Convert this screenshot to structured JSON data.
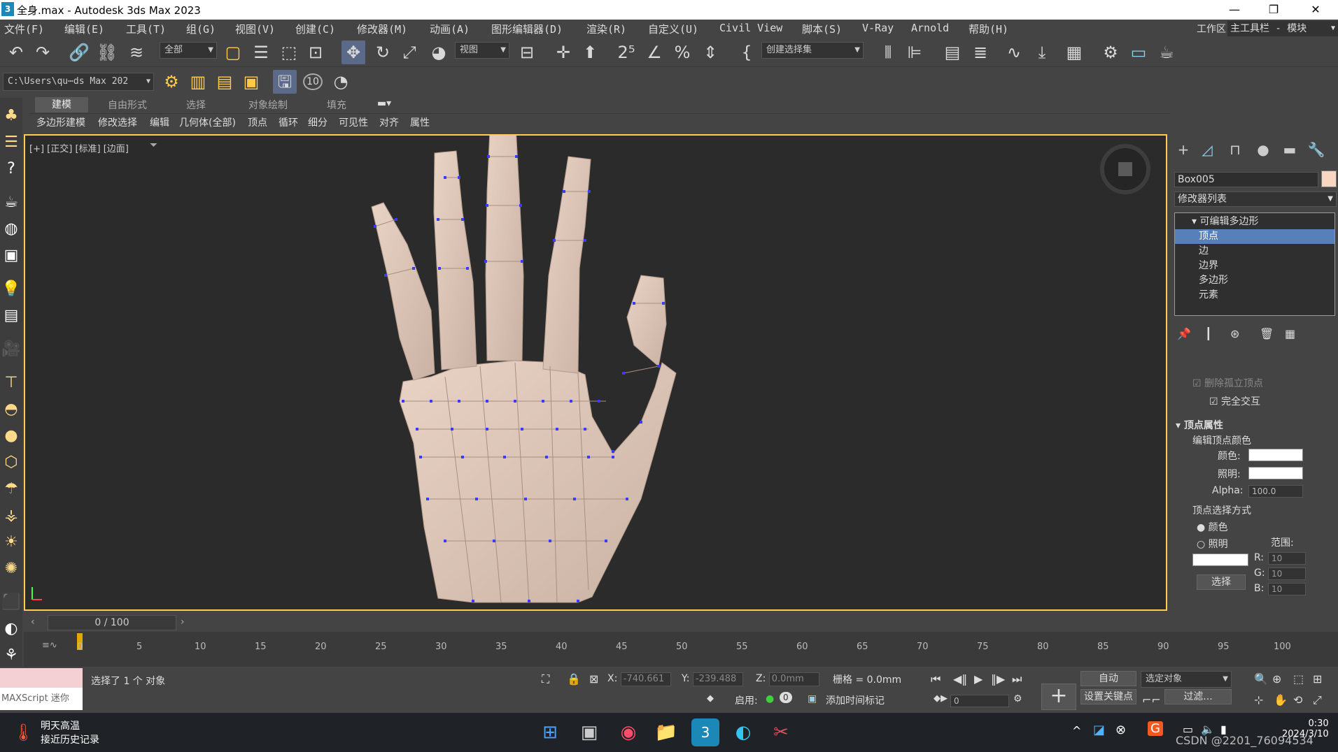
{
  "window": {
    "title": "全身.max - Autodesk 3ds Max 2023",
    "app_icon": "3"
  },
  "menu": [
    "文件(F)",
    "编辑(E)",
    "工具(T)",
    "组(G)",
    "视图(V)",
    "创建(C)",
    "修改器(M)",
    "动画(A)",
    "图形编辑器(D)",
    "渲染(R)",
    "自定义(U)",
    "Civil View",
    "脚本(S)",
    "V-Ray",
    "Arnold",
    "帮助(H)"
  ],
  "workspace": {
    "label": "工作区:",
    "value": "主工具栏 - 模块"
  },
  "toolbar": {
    "selection_filter": "全部",
    "ref_coord": "视图",
    "named_selection": "创建选择集",
    "project_path": "C:\\Users\\qu⋯ds Max 202",
    "numeric": "10"
  },
  "ribbon": {
    "tabs": [
      "建模",
      "自由形式",
      "选择",
      "对象绘制",
      "填充"
    ],
    "panel": [
      "多边形建模",
      "修改选择",
      "编辑",
      "几何体(全部)",
      "顶点",
      "循环",
      "细分",
      "可见性",
      "对齐",
      "属性"
    ]
  },
  "viewport": {
    "label": "[+] [正交] [标准] [边面]"
  },
  "command_panel": {
    "object_name": "Box005",
    "object_color": "#f7d7c2",
    "modifier_list": "修改器列表",
    "stack": [
      "可编辑多边形",
      "顶点",
      "边",
      "边界",
      "多边形",
      "元素"
    ],
    "options": {
      "delete_isolated": "删除孤立顶点",
      "full_interactivity": "完全交互"
    },
    "vertex_props": {
      "title": "顶点属性",
      "edit_color_group": "编辑顶点颜色",
      "color_label": "颜色:",
      "illum_label": "照明:",
      "alpha_label": "Alpha:",
      "alpha_value": "100.0",
      "select_by_group": "顶点选择方式",
      "radio_color": "颜色",
      "radio_illum": "照明",
      "range_label": "范围:",
      "r_label": "R:",
      "r_value": "10",
      "g_label": "G:",
      "g_value": "10",
      "b_label": "B:",
      "b_value": "10",
      "select_button": "选择"
    }
  },
  "timeline": {
    "slider": "0 / 100",
    "ticks": [
      "5",
      "10",
      "15",
      "20",
      "25",
      "30",
      "35",
      "40",
      "45",
      "50",
      "55",
      "60",
      "65",
      "70",
      "75",
      "80",
      "85",
      "90",
      "95",
      "100"
    ],
    "start": "0"
  },
  "status": {
    "maxscript": "MAXScript 迷你",
    "message": "选择了 1 个 对象",
    "x_label": "X:",
    "x_value": "-740.661",
    "y_label": "Y:",
    "y_value": "-239.488",
    "z_label": "Z:",
    "z_value": "0.0mm",
    "grid": "栅格 = 0.0mm",
    "enable_label": "启用:",
    "add_time_tag": "添加时间标记",
    "auto_key": "自动",
    "set_key": "设置关键点",
    "key_filter_select": "选定对象",
    "filters": "过滤...",
    "frame_value": "0",
    "enable_value": "0"
  },
  "taskbar": {
    "weather_title": "明天高温",
    "weather_sub": "接近历史记录",
    "time": "0:30",
    "date": "2024/3/10",
    "watermark": "CSDN @2201_76094534"
  }
}
